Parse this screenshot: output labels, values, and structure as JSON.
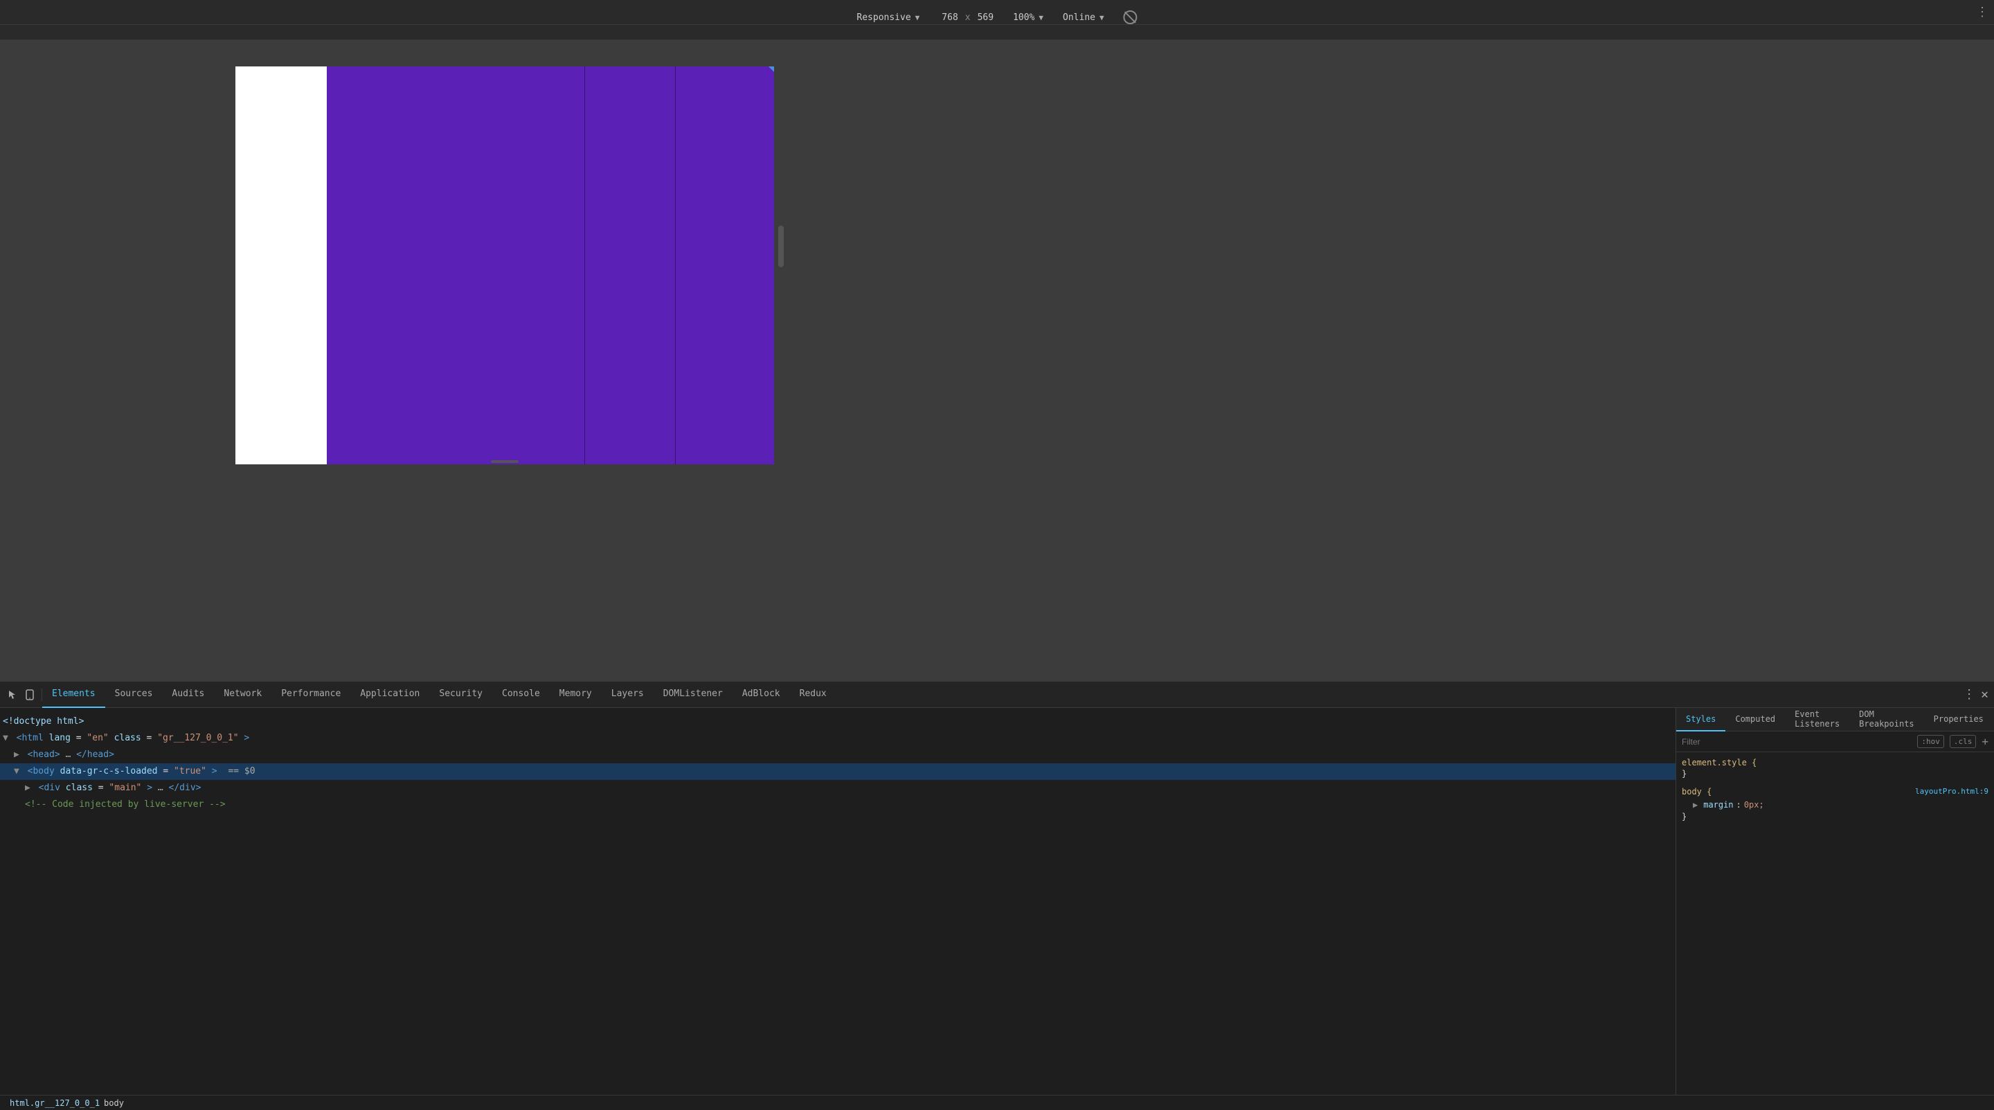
{
  "toolbar": {
    "device_label": "Responsive",
    "width": "768",
    "height": "569",
    "separator": "x",
    "zoom": "100%",
    "zoom_arrow": "▼",
    "online": "Online",
    "online_arrow": "▼",
    "more_dots": "⋮"
  },
  "devtools": {
    "tabs": [
      {
        "id": "elements",
        "label": "Elements",
        "active": true
      },
      {
        "id": "sources",
        "label": "Sources",
        "active": false
      },
      {
        "id": "audits",
        "label": "Audits",
        "active": false
      },
      {
        "id": "network",
        "label": "Network",
        "active": false
      },
      {
        "id": "performance",
        "label": "Performance",
        "active": false
      },
      {
        "id": "application",
        "label": "Application",
        "active": false
      },
      {
        "id": "security",
        "label": "Security",
        "active": false
      },
      {
        "id": "console",
        "label": "Console",
        "active": false
      },
      {
        "id": "memory",
        "label": "Memory",
        "active": false
      },
      {
        "id": "layers",
        "label": "Layers",
        "active": false
      },
      {
        "id": "domlistener",
        "label": "DOMListener",
        "active": false
      },
      {
        "id": "adblock",
        "label": "AdBlock",
        "active": false
      },
      {
        "id": "redux",
        "label": "Redux",
        "active": false
      }
    ],
    "html_lines": [
      {
        "indent": 0,
        "content": "<!doctype html>",
        "type": "doctype"
      },
      {
        "indent": 0,
        "content": "<html lang=\"en\" class=\"gr__127_0_0_1\">",
        "type": "tag"
      },
      {
        "indent": 1,
        "content": "▶ <head>…</head>",
        "type": "collapsed"
      },
      {
        "indent": 1,
        "content": "▼ <body data-gr-c-s-loaded=\"true\"> == $0",
        "type": "tag-selected"
      },
      {
        "indent": 2,
        "content": "▶ <div class=\"main\">…</div>",
        "type": "collapsed"
      },
      {
        "indent": 2,
        "content": "<!-- Code injected by live-server -->",
        "type": "comment"
      }
    ],
    "breadcrumb": [
      {
        "label": "html.gr__127_0_0_1"
      },
      {
        "label": "body"
      }
    ],
    "styles": {
      "tabs": [
        {
          "id": "styles",
          "label": "Styles",
          "active": true
        },
        {
          "id": "computed",
          "label": "Computed",
          "active": false
        },
        {
          "id": "event-listeners",
          "label": "Event Listeners",
          "active": false
        },
        {
          "id": "dom-breakpoints",
          "label": "DOM Breakpoints",
          "active": false
        },
        {
          "id": "properties",
          "label": "Properties",
          "active": false
        }
      ],
      "filter_placeholder": "Filter",
      "filter_hov": ":hov",
      "filter_cls": ".cls",
      "filter_add": "+",
      "rules": [
        {
          "selector": "element.style {",
          "close": "}",
          "properties": []
        },
        {
          "selector": "body {",
          "close": "}",
          "source": "layoutPro.html:9",
          "properties": [
            {
              "name": "margin",
              "value": "▶ 0px;"
            }
          ]
        }
      ]
    }
  }
}
